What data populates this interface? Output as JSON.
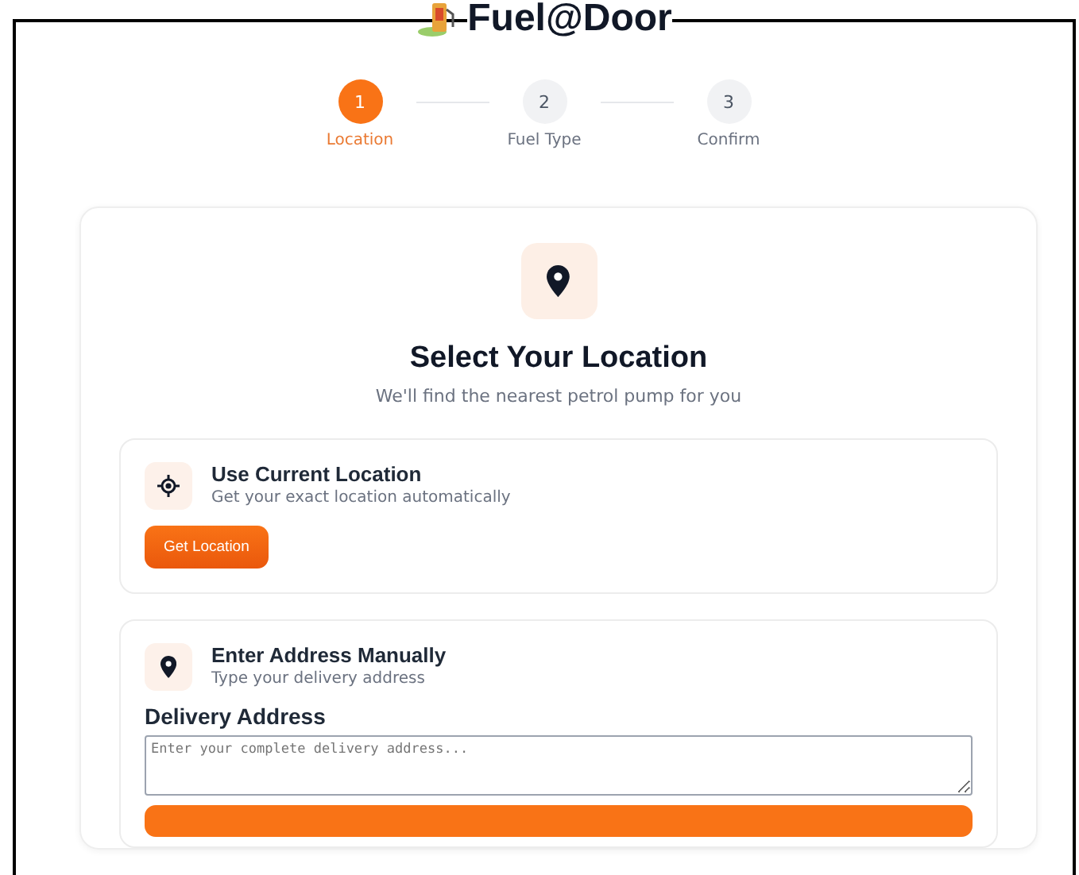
{
  "header": {
    "title": "Fuel@Door"
  },
  "steps": [
    {
      "number": "1",
      "label": "Location",
      "selected": true
    },
    {
      "number": "2",
      "label": "Fuel Type",
      "selected": false
    },
    {
      "number": "3",
      "label": "Confirm",
      "selected": false
    }
  ],
  "card": {
    "heading": "Select Your Location",
    "subtitle": "We'll find the nearest petrol pump for you"
  },
  "current_location": {
    "title": "Use Current Location",
    "subtitle": "Get your exact location automatically",
    "button": "Get Location"
  },
  "manual_address": {
    "title": "Enter Address Manually",
    "subtitle": "Type your delivery address",
    "field_label": "Delivery Address",
    "placeholder": "Enter your complete delivery address..."
  }
}
